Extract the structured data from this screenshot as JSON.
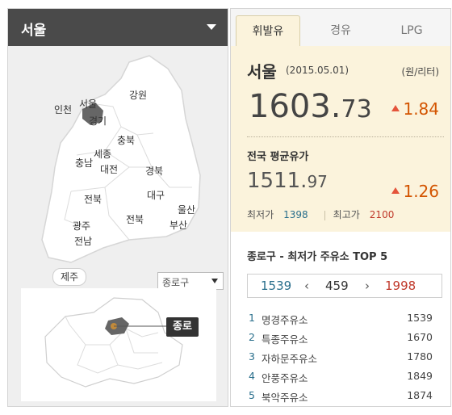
{
  "region_selector": {
    "selected": "서울"
  },
  "map": {
    "labels": [
      "인천",
      "서울",
      "강원",
      "경기",
      "충북",
      "세종",
      "충남",
      "대전",
      "경북",
      "대구",
      "울산",
      "전북",
      "경남",
      "부산",
      "광주",
      "전남",
      "제주"
    ],
    "district_select": {
      "value": "종로구"
    },
    "district_tag": "종로"
  },
  "tabs": [
    {
      "label": "휘발유",
      "active": true
    },
    {
      "label": "경유",
      "active": false
    },
    {
      "label": "LPG",
      "active": false
    }
  ],
  "current": {
    "city": "서울",
    "date": "(2015.05.01)",
    "unit": "(원/리터)",
    "price_int": "1603.",
    "price_dec": "73",
    "change": "1.84"
  },
  "national": {
    "title": "전국 평균유가",
    "price_int": "1511.",
    "price_dec": "97",
    "change": "1.26",
    "min_label": "최저가",
    "min_value": "1398",
    "max_label": "최고가",
    "max_value": "2100"
  },
  "top5": {
    "title": "종로구 - 최저가 주유소 TOP 5",
    "pager": {
      "min": "1539",
      "mid": "459",
      "max": "1998"
    },
    "stations": [
      {
        "rank": "1",
        "name": "명경주유소",
        "price": "1539"
      },
      {
        "rank": "2",
        "name": "특종주유소",
        "price": "1670"
      },
      {
        "rank": "3",
        "name": "자하문주유소",
        "price": "1780"
      },
      {
        "rank": "4",
        "name": "안풍주유소",
        "price": "1849"
      },
      {
        "rank": "5",
        "name": "북악주유소",
        "price": "1874"
      }
    ]
  },
  "colors": {
    "tab_bg": "#fbf3dc",
    "up": "#e4543b",
    "min": "#2a6f8c",
    "max": "#c0392b"
  }
}
